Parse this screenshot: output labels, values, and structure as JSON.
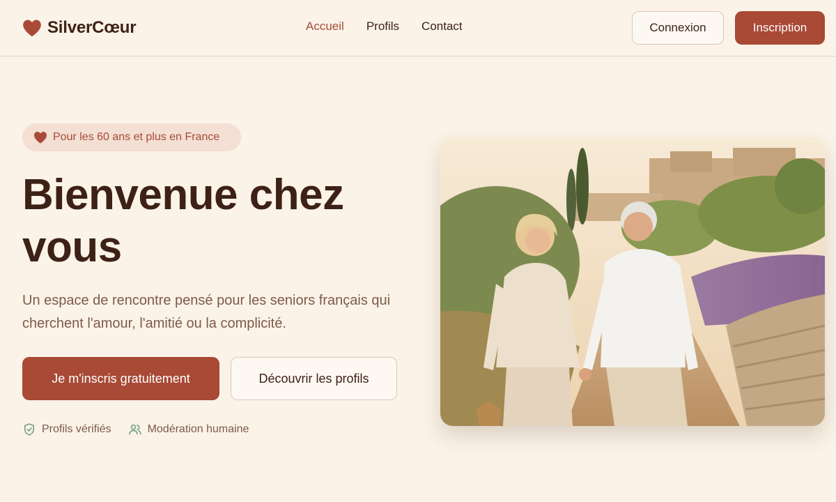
{
  "brand": {
    "name": "SilverCœur",
    "logo_icon": "heart-icon",
    "accent_color": "#a84a36"
  },
  "nav": {
    "items": [
      {
        "label": "Accueil",
        "active": true
      },
      {
        "label": "Profils",
        "active": false
      },
      {
        "label": "Contact",
        "active": false
      }
    ]
  },
  "header_actions": {
    "login_label": "Connexion",
    "signup_label": "Inscription"
  },
  "hero": {
    "badge": {
      "icon": "heart-icon",
      "text": "Pour les 60 ans et plus en France"
    },
    "title": "Bienvenue chez vous",
    "subtitle": "Un espace de rencontre pensé pour les seniors français qui cherchent l'amour, l'amitié ou la complicité.",
    "primary_cta": "Je m'inscris gratuitement",
    "secondary_cta": "Découvrir les profils",
    "trust": [
      {
        "icon": "shield-check-icon",
        "label": "Profils vérifiés"
      },
      {
        "icon": "users-icon",
        "label": "Modération humaine"
      }
    ]
  }
}
